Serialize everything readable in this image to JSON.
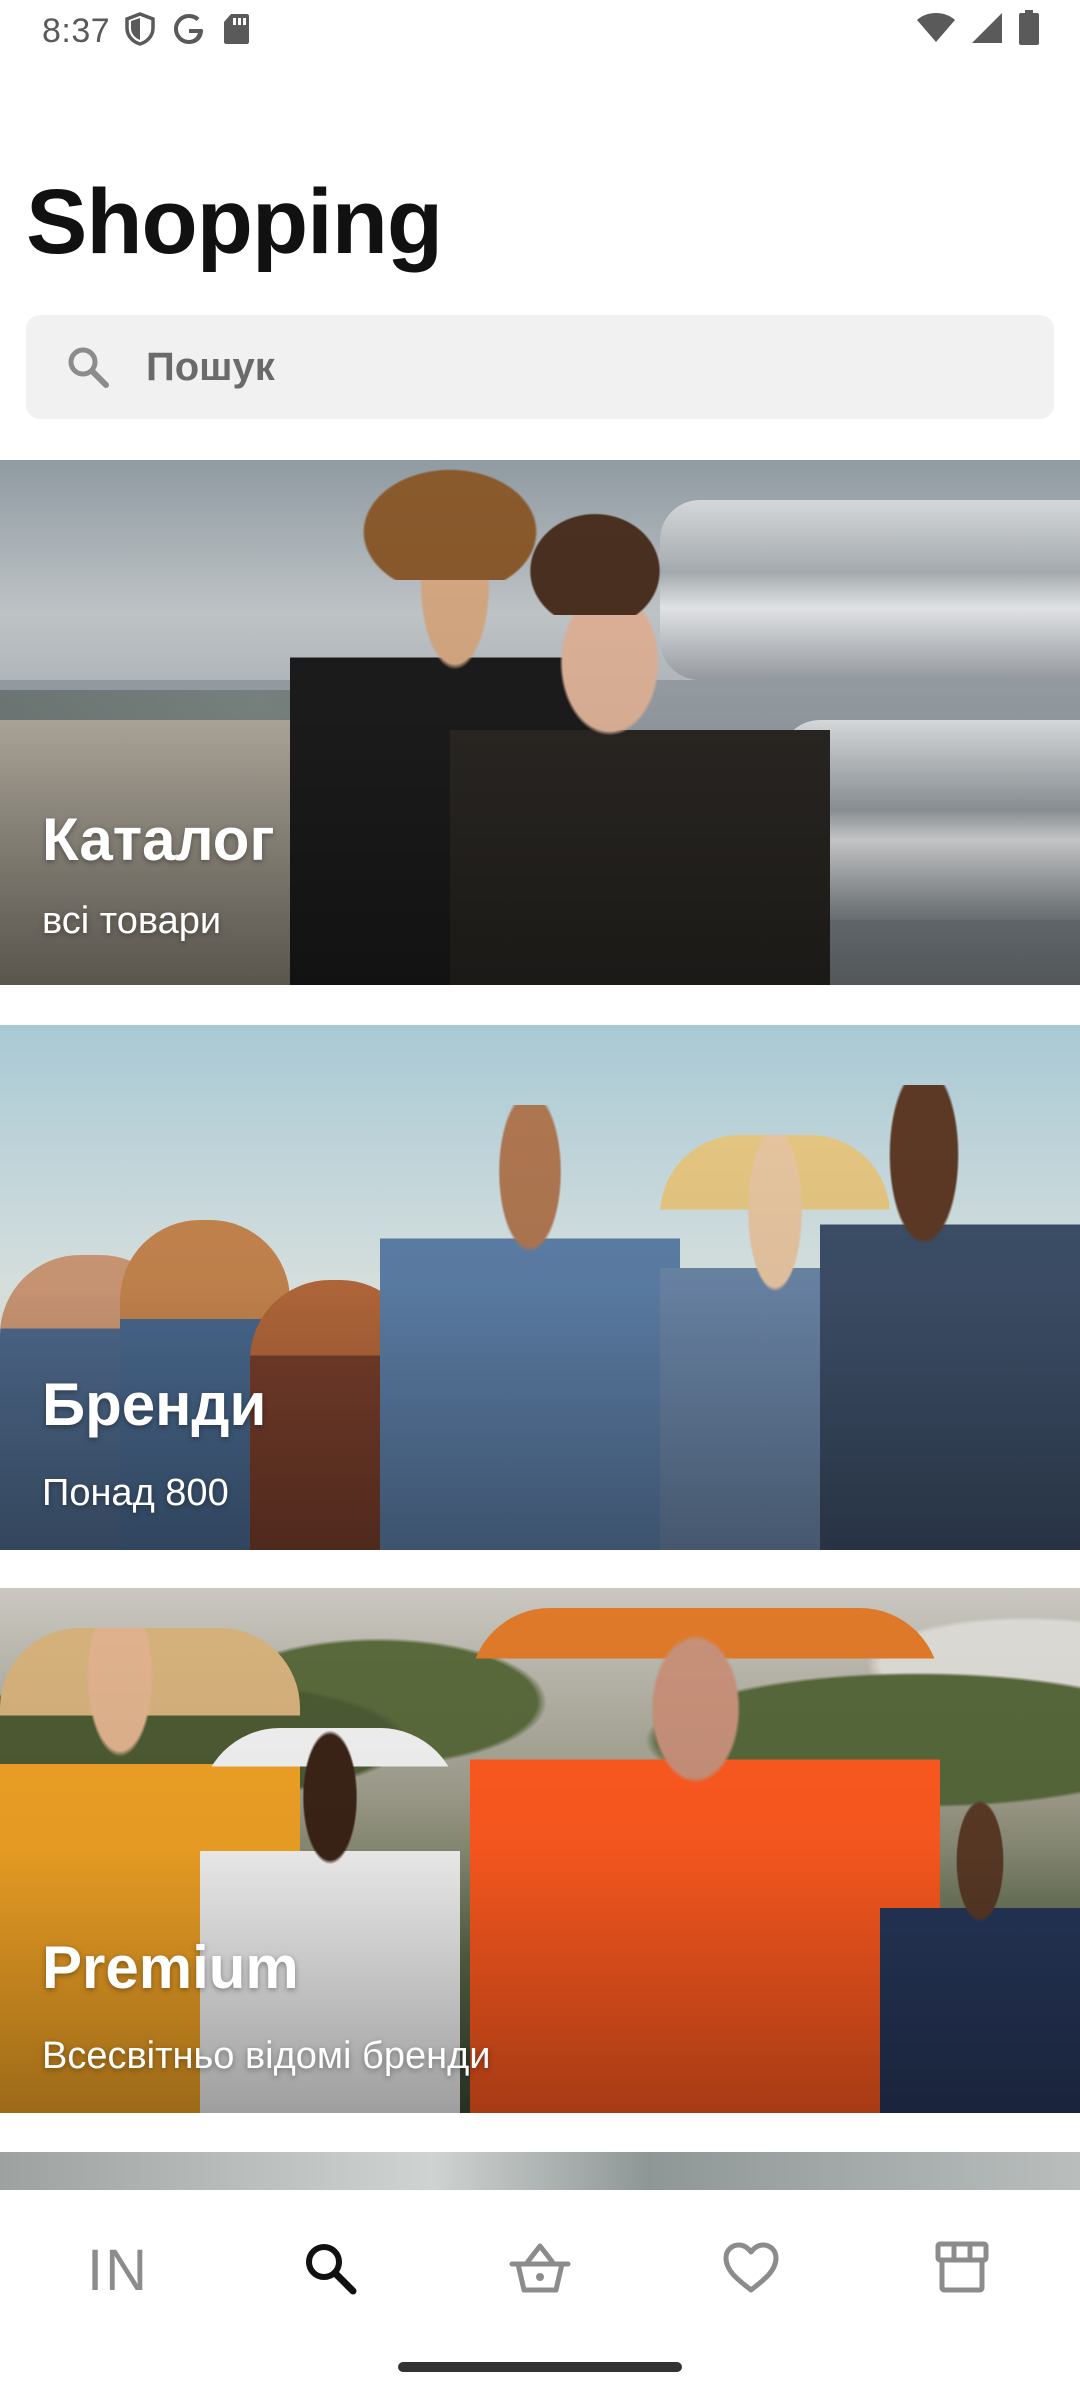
{
  "status_bar": {
    "time": "8:37",
    "left_icons": [
      "shield-icon",
      "google-icon",
      "sd-card-icon"
    ],
    "right_icons": [
      "wifi-icon",
      "signal-icon",
      "battery-icon"
    ]
  },
  "page": {
    "title": "Shopping"
  },
  "search": {
    "placeholder": "Пошук",
    "icon": "search-icon"
  },
  "cards": [
    {
      "title": "Каталог",
      "subtitle": "всі товари"
    },
    {
      "title": "Бренди",
      "subtitle": "Понад 800"
    },
    {
      "title": "Premium",
      "subtitle": "Всесвітньо відомі бренди"
    }
  ],
  "bottom_nav": {
    "home_label": "IN",
    "items": [
      {
        "name": "home",
        "icon": "in-logo"
      },
      {
        "name": "search",
        "icon": "search-icon",
        "active": true
      },
      {
        "name": "basket",
        "icon": "basket-icon"
      },
      {
        "name": "wishlist",
        "icon": "heart-icon"
      },
      {
        "name": "stores",
        "icon": "store-icon"
      }
    ]
  },
  "colors": {
    "background": "#ffffff",
    "search_bg": "#f1f1f1",
    "text_primary": "#111111",
    "nav_inactive": "#8c8c8c",
    "nav_active": "#111111"
  }
}
